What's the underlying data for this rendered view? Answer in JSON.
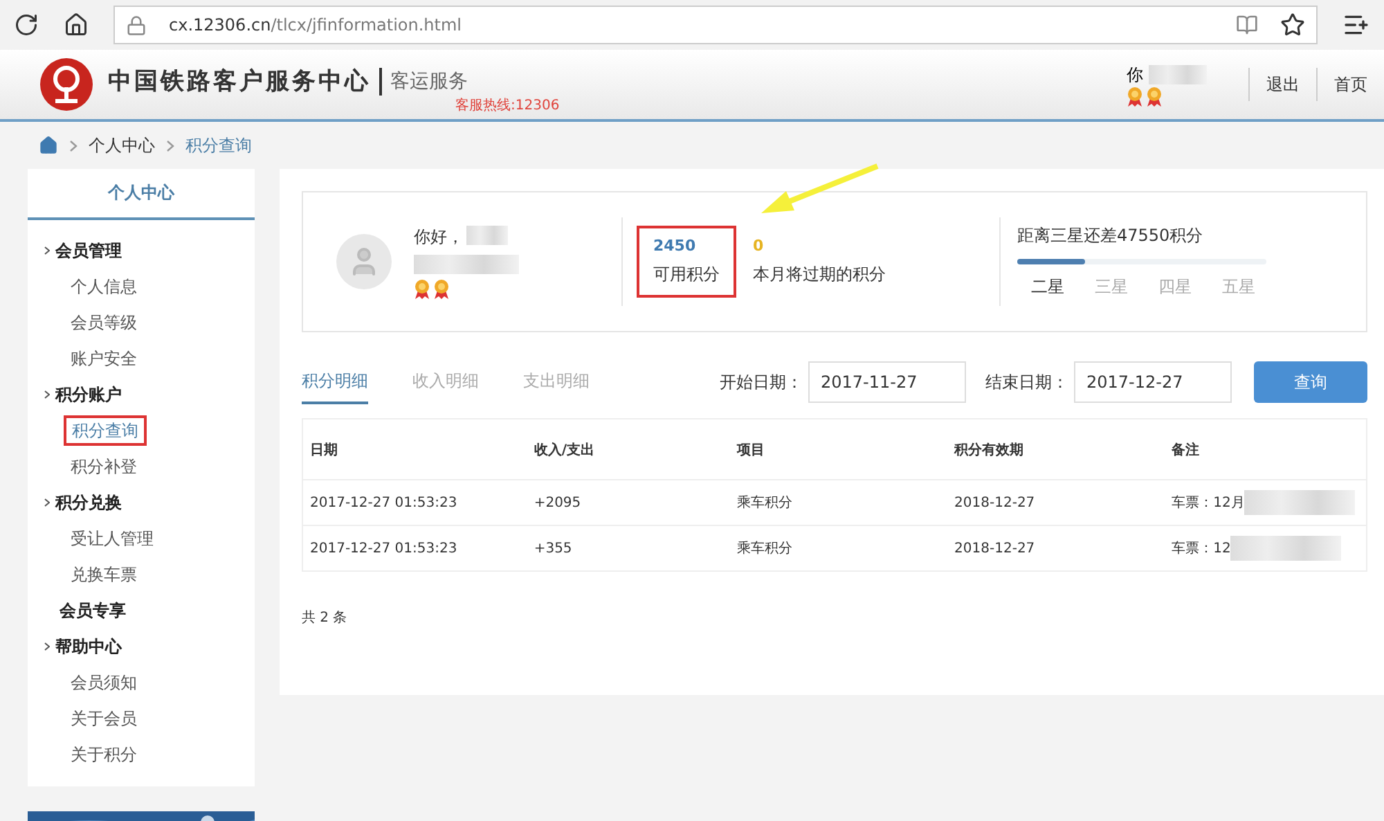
{
  "browser": {
    "url_host": "cx.12306.cn",
    "url_path": "/tlcx/jfinformation.html"
  },
  "header": {
    "logo_text": "中国铁路客户服务中心",
    "service": "客运服务",
    "hotline": "客服热线:12306",
    "greeting": "你",
    "links": [
      "退出",
      "首页"
    ]
  },
  "breadcrumb": [
    "个人中心",
    "积分查询"
  ],
  "sidebar": {
    "title": "个人中心",
    "groups": [
      {
        "label": "会员管理",
        "arrow": true,
        "items": [
          {
            "label": "个人信息",
            "selected": false,
            "highlighted": false
          },
          {
            "label": "会员等级",
            "selected": false,
            "highlighted": false
          },
          {
            "label": "账户安全",
            "selected": false,
            "highlighted": false
          }
        ]
      },
      {
        "label": "积分账户",
        "arrow": true,
        "items": [
          {
            "label": "积分查询",
            "selected": true,
            "highlighted": true
          },
          {
            "label": "积分补登",
            "selected": false,
            "highlighted": false
          }
        ]
      },
      {
        "label": "积分兑换",
        "arrow": true,
        "items": [
          {
            "label": "受让人管理",
            "selected": false,
            "highlighted": false
          },
          {
            "label": "兑换车票",
            "selected": false,
            "highlighted": false
          }
        ]
      },
      {
        "label": "会员专享",
        "arrow": false
      },
      {
        "label": "帮助中心",
        "arrow": true,
        "items": [
          {
            "label": "会员须知",
            "selected": false,
            "highlighted": false
          },
          {
            "label": "关于会员",
            "selected": false,
            "highlighted": false
          },
          {
            "label": "关于积分",
            "selected": false,
            "highlighted": false
          }
        ]
      }
    ]
  },
  "summary": {
    "greeting": "你好，",
    "available": {
      "value": "2450",
      "label": "可用积分",
      "highlighted": true
    },
    "expiring": {
      "value": "0",
      "label": "本月将过期的积分"
    },
    "progress": {
      "text": "距离三星还差47550积分",
      "level": 0.27,
      "stars": [
        {
          "label": "二星",
          "selected": true
        },
        {
          "label": "三星",
          "selected": false
        },
        {
          "label": "四星",
          "selected": false
        },
        {
          "label": "五星",
          "selected": false
        }
      ]
    }
  },
  "tabs": [
    {
      "label": "积分明细",
      "selected": true
    },
    {
      "label": "收入明细",
      "selected": false
    },
    {
      "label": "支出明细",
      "selected": false
    }
  ],
  "filters": {
    "start_label": "开始日期：",
    "start": "2017-11-27",
    "end_label": "结束日期：",
    "end": "2017-12-27",
    "button": "查询"
  },
  "table": {
    "columns": [
      "日期",
      "收入/支出",
      "项目",
      "积分有效期",
      "备注"
    ],
    "rows": [
      [
        "2017-12-27 01:53:23",
        "+2095",
        "乘车积分",
        "2018-12-27",
        "车票：12月"
      ],
      [
        "2017-12-27 01:53:23",
        "+355",
        "乘车积分",
        "2018-12-27",
        "车票：12"
      ]
    ]
  },
  "total": "共 2 条"
}
